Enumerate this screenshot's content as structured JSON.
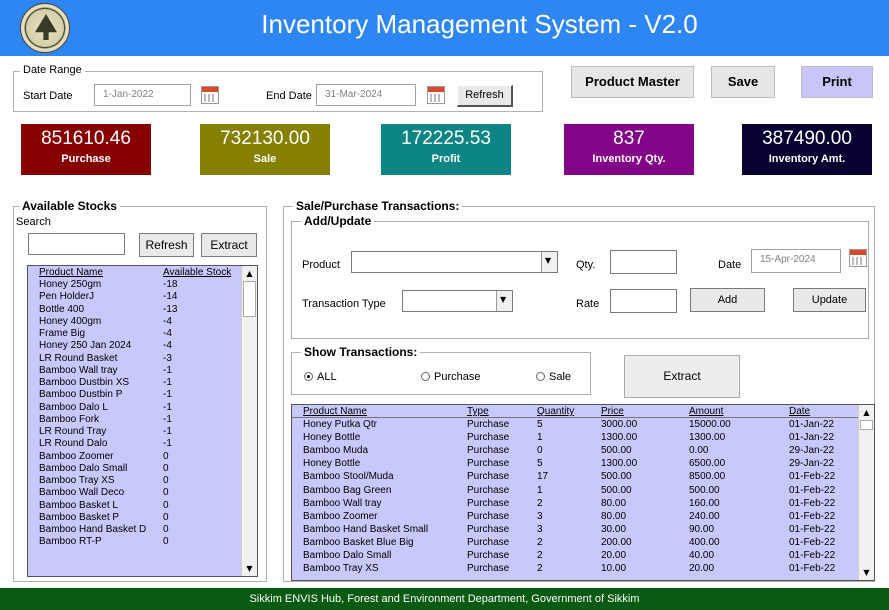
{
  "header": {
    "title": "Inventory Management System - V2.0"
  },
  "date_range": {
    "legend": "Date Range",
    "start_label": "Start Date",
    "start_value": "1-Jan-2022",
    "end_label": "End Date",
    "end_value": "31-Mar-2024",
    "refresh_label": "Refresh"
  },
  "toolbar": {
    "product_master": "Product Master",
    "save": "Save",
    "print": "Print"
  },
  "tiles": [
    {
      "value": "851610.46",
      "caption": "Purchase",
      "color": "#870000"
    },
    {
      "value": "732130.00",
      "caption": "Sale",
      "color": "#858000"
    },
    {
      "value": "172225.53",
      "caption": "Profit",
      "color": "#0d8585"
    },
    {
      "value": "837",
      "caption": "Inventory Qty.",
      "color": "#820587"
    },
    {
      "value": "387490.00",
      "caption": "Inventory Amt.",
      "color": "#09002f"
    }
  ],
  "stocks": {
    "legend": "Available Stocks",
    "search_label": "Search",
    "search_value": "",
    "refresh_label": "Refresh",
    "extract_label": "Extract",
    "columns": [
      "Product Name",
      "Available Stock"
    ],
    "rows": [
      [
        "Honey 250gm",
        "-18"
      ],
      [
        "Pen HolderJ",
        "-14"
      ],
      [
        "Bottle 400",
        "-13"
      ],
      [
        "Honey 400gm",
        "-4"
      ],
      [
        "Frame Big",
        "-4"
      ],
      [
        "Honey 250 Jan 2024",
        "-4"
      ],
      [
        "LR Round Basket",
        "-3"
      ],
      [
        "Bamboo Wall tray",
        "-1"
      ],
      [
        "Bamboo Dustbin XS",
        "-1"
      ],
      [
        "Bamboo Dustbin P",
        "-1"
      ],
      [
        "Bamboo Dalo L",
        "-1"
      ],
      [
        "Bamboo Fork",
        "-1"
      ],
      [
        "LR Round Tray",
        "-1"
      ],
      [
        "LR Round Dalo",
        "-1"
      ],
      [
        "Bamboo Zoomer",
        "0"
      ],
      [
        "Bamboo Dalo Small",
        "0"
      ],
      [
        "Bamboo Tray XS",
        "0"
      ],
      [
        "Bamboo Wall Deco",
        "0"
      ],
      [
        "Bamboo Basket L",
        "0"
      ],
      [
        "Bamboo Basket P",
        "0"
      ],
      [
        "Bamboo Hand Basket D",
        "0"
      ],
      [
        "Bamboo RT-P",
        "0"
      ]
    ]
  },
  "transactions": {
    "legend": "Sale/Purchase Transactions:",
    "add_legend": "Add/Update",
    "product_label": "Product",
    "qty_label": "Qty.",
    "date_label": "Date",
    "date_value": "15-Apr-2024",
    "type_label": "Transaction Type",
    "rate_label": "Rate",
    "add_label": "Add",
    "update_label": "Update",
    "show_legend": "Show Transactions:",
    "radio_all": "ALL",
    "radio_purchase": "Purchase",
    "radio_sale": "Sale",
    "extract_label": "Extract",
    "columns": [
      "Product Name",
      "Type",
      "Quantity",
      "Price",
      "Amount",
      "Date"
    ],
    "rows": [
      [
        "Honey Putka Qtr",
        "Purchase",
        "5",
        "3000.00",
        "15000.00",
        "01-Jan-22"
      ],
      [
        "Honey Bottle",
        "Purchase",
        "1",
        "1300.00",
        "1300.00",
        "01-Jan-22"
      ],
      [
        "Bamboo Muda",
        "Purchase",
        "0",
        "500.00",
        "0.00",
        "29-Jan-22"
      ],
      [
        "Honey Bottle",
        "Purchase",
        "5",
        "1300.00",
        "6500.00",
        "29-Jan-22"
      ],
      [
        "Bamboo Stool/Muda",
        "Purchase",
        "17",
        "500.00",
        "8500.00",
        "01-Feb-22"
      ],
      [
        "Bamboo Bag Green",
        "Purchase",
        "1",
        "500.00",
        "500.00",
        "01-Feb-22"
      ],
      [
        "Bamboo Wall tray",
        "Purchase",
        "2",
        "80.00",
        "160.00",
        "01-Feb-22"
      ],
      [
        "Bamboo Zoomer",
        "Purchase",
        "3",
        "80.00",
        "240.00",
        "01-Feb-22"
      ],
      [
        "Bamboo Hand Basket Small",
        "Purchase",
        "3",
        "30.00",
        "90.00",
        "01-Feb-22"
      ],
      [
        "Bamboo Basket Blue Big",
        "Purchase",
        "2",
        "200.00",
        "400.00",
        "01-Feb-22"
      ],
      [
        "Bamboo Dalo Small",
        "Purchase",
        "2",
        "20.00",
        "40.00",
        "01-Feb-22"
      ],
      [
        "Bamboo Tray XS",
        "Purchase",
        "2",
        "10.00",
        "20.00",
        "01-Feb-22"
      ]
    ]
  },
  "footer": {
    "text": "Sikkim ENVIS Hub, Forest and Environment Department, Government of Sikkim"
  }
}
